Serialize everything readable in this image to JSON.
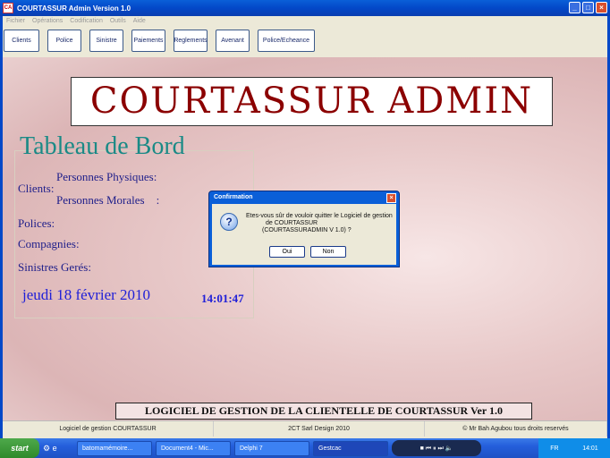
{
  "window": {
    "title": "COURTASSUR Admin Version 1.0",
    "icon": "app-logo-icon"
  },
  "menu": [
    "Fichier",
    "Opérations",
    "Codification",
    "Outils",
    "Aide"
  ],
  "toolbar": [
    "Clients",
    "Police",
    "Sinistre",
    "Paiements",
    "Reglements",
    "Avenant",
    "Police/Echeance"
  ],
  "banner": "COURTASSUR ADMIN",
  "dashboard": {
    "title": "Tableau de Bord",
    "clients": "Clients:",
    "physiques": "Personnes Physiques:",
    "morales": "Personnes Morales    :",
    "polices": "Polices:",
    "compagnies": "Compagnies:",
    "sinistres": "Sinistres Gerés:",
    "date": "jeudi 18 février 2010",
    "time": "14:01:47"
  },
  "footer_title": "LOGICIEL DE GESTION DE LA CLIENTELLE DE COURTASSUR Ver 1.0",
  "status": [
    "Logiciel de gestion COURTASSUR",
    "2CT Sarl Design 2010",
    "© Mr Bah Agubou tous droits reservés"
  ],
  "dialog": {
    "title": "Confirmation",
    "line1": "Etes-vous sûr de vouloir quitter le Logiciel de gestion",
    "line2": "de COURTASSUR",
    "line3": "(COURTASSURADMIN V 1.0) ?",
    "yes": "Oui",
    "no": "Non",
    "icon": "question-icon"
  },
  "taskbar": {
    "start": "start",
    "tasks": [
      "batomamémoire...",
      "Document4 - Mic...",
      "Delphi 7",
      "Gestcac"
    ],
    "lang": "FR",
    "clock": "14:01"
  },
  "colors": {
    "banner": "#8b0000",
    "title": "#1a8a86",
    "labels": "#1e1e8a",
    "date": "#2020d8"
  }
}
